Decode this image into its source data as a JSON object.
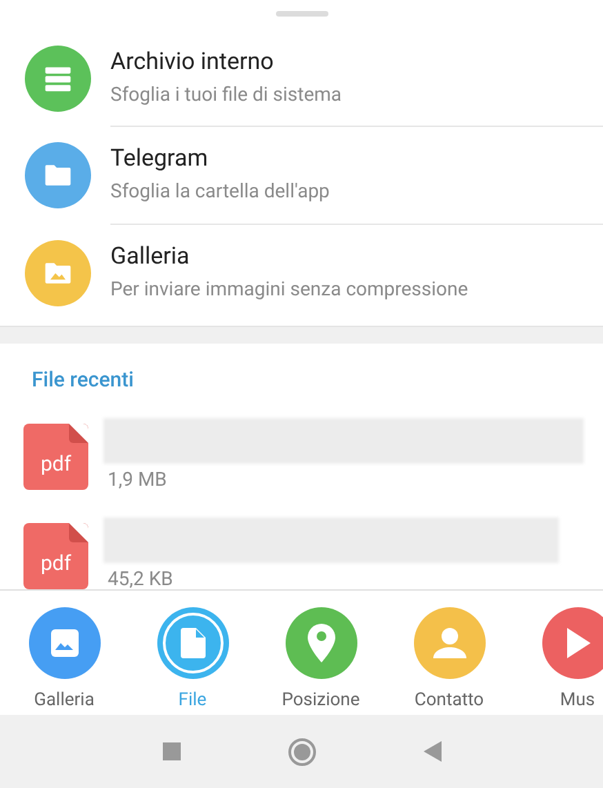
{
  "sources": [
    {
      "kind": "storage",
      "title": "Archivio interno",
      "subtitle": "Sfoglia i tuoi file di sistema",
      "color": "#5cc15a"
    },
    {
      "kind": "folder",
      "title": "Telegram",
      "subtitle": "Sfoglia la cartella dell'app",
      "color": "#5aade8"
    },
    {
      "kind": "gallery",
      "title": "Galleria",
      "subtitle": "Per inviare immagini senza compressione",
      "color": "#f4c44a"
    }
  ],
  "recent": {
    "title": "File recenti",
    "files": [
      {
        "ext": "pdf",
        "size": "1,9 MB"
      },
      {
        "ext": "pdf",
        "size": "45,2 KB"
      }
    ]
  },
  "attach_bar": [
    {
      "kind": "gallery",
      "label": "Galleria",
      "color": "#469ef3",
      "selected": false
    },
    {
      "kind": "file",
      "label": "File",
      "color": "#3cb4ee",
      "selected": true
    },
    {
      "kind": "location",
      "label": "Posizione",
      "color": "#5ebd53",
      "selected": false
    },
    {
      "kind": "contact",
      "label": "Contatto",
      "color": "#f4c04a",
      "selected": false
    },
    {
      "kind": "music",
      "label": "Mus",
      "color": "#ec6161",
      "selected": false
    }
  ]
}
